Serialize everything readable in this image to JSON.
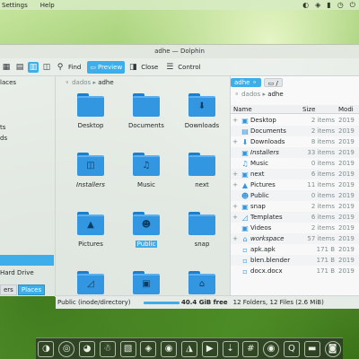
{
  "menubar": {
    "items": [
      "Settings",
      "Help"
    ]
  },
  "tray": {
    "icons": [
      "volume-icon",
      "network-icon",
      "battery-icon",
      "clock-icon",
      "power-icon"
    ]
  },
  "window": {
    "title": "adhe — Dolphin"
  },
  "toolbar": {
    "find_label": "Find",
    "preview_label": "Preview",
    "close_label": "Close",
    "control_label": "Control"
  },
  "places": {
    "title": "laces",
    "items": [
      "ts",
      "ds"
    ],
    "selected": "",
    "hard_drive": "Hard Drive",
    "tabs": [
      "ers",
      "Places"
    ]
  },
  "iconview": {
    "breadcrumb": {
      "parent": "dados",
      "current": "adhe"
    },
    "tiles": [
      {
        "label": "Desktop",
        "glyph": ""
      },
      {
        "label": "Documents",
        "glyph": ""
      },
      {
        "label": "Downloads",
        "glyph": "⬇"
      },
      {
        "label": "Installers",
        "glyph": "◫",
        "italic": true
      },
      {
        "label": "Music",
        "glyph": "♫"
      },
      {
        "label": "next",
        "glyph": ""
      },
      {
        "label": "Pictures",
        "glyph": "▲"
      },
      {
        "label": "Public",
        "glyph": "☻",
        "selected": true
      },
      {
        "label": "snap",
        "glyph": ""
      },
      {
        "label": "Templates",
        "glyph": "◿"
      },
      {
        "label": "Videos",
        "glyph": "▣"
      },
      {
        "label": "workspace",
        "glyph": "⌂",
        "italic": true
      }
    ]
  },
  "details": {
    "tab_active": "adhe",
    "tab_other": "/",
    "breadcrumb": {
      "parent": "dados",
      "current": "adhe"
    },
    "columns": {
      "name": "Name",
      "size": "Size",
      "modified": "Modi"
    },
    "rows": [
      {
        "name": "Desktop",
        "size": "2 items",
        "modified": "2019",
        "icon": "▣",
        "expand": "+"
      },
      {
        "name": "Documents",
        "size": "2 items",
        "modified": "2019",
        "icon": "▤",
        "expand": ""
      },
      {
        "name": "Downloads",
        "size": "8 items",
        "modified": "2019",
        "icon": "⬇",
        "expand": "+"
      },
      {
        "name": "Installers",
        "size": "33 items",
        "modified": "2019",
        "icon": "▣",
        "expand": "",
        "italic": true
      },
      {
        "name": "Music",
        "size": "0 items",
        "modified": "2019",
        "icon": "♫",
        "expand": ""
      },
      {
        "name": "next",
        "size": "6 items",
        "modified": "2019",
        "icon": "▣",
        "expand": "+"
      },
      {
        "name": "Pictures",
        "size": "11 items",
        "modified": "2019",
        "icon": "▲",
        "expand": "+"
      },
      {
        "name": "Public",
        "size": "0 items",
        "modified": "2019",
        "icon": "☻",
        "expand": ""
      },
      {
        "name": "snap",
        "size": "2 items",
        "modified": "2019",
        "icon": "▣",
        "expand": "+"
      },
      {
        "name": "Templates",
        "size": "6 items",
        "modified": "2019",
        "icon": "◿",
        "expand": "+"
      },
      {
        "name": "Videos",
        "size": "2 items",
        "modified": "2019",
        "icon": "▣",
        "expand": ""
      },
      {
        "name": "workspace",
        "size": "57 items",
        "modified": "2019",
        "icon": "⌂",
        "expand": "+",
        "italic": true
      },
      {
        "name": "apk.apk",
        "size": "171 B",
        "modified": "2019",
        "icon": "▫",
        "expand": ""
      },
      {
        "name": "blen.blender",
        "size": "171 B",
        "modified": "2019",
        "icon": "▫",
        "expand": ""
      },
      {
        "name": "docx.docx",
        "size": "171 B",
        "modified": "2019",
        "icon": "▫",
        "expand": ""
      }
    ]
  },
  "statusbar": {
    "selection": "Public (inode/directory)",
    "free_space": "40.4 GiB free",
    "summary": "12 Folders, 12 Files (2.6 MiB)"
  },
  "dock": {
    "icons": [
      "toggle-icon",
      "disk-icon",
      "firefox-icon",
      "tux-icon",
      "image-editor-icon",
      "gimp-icon",
      "blender-icon",
      "inkscape-icon",
      "terminal-icon",
      "markdown-icon",
      "hash-icon",
      "eye-icon",
      "qt-icon",
      "video-icon",
      "camera-icon"
    ]
  }
}
